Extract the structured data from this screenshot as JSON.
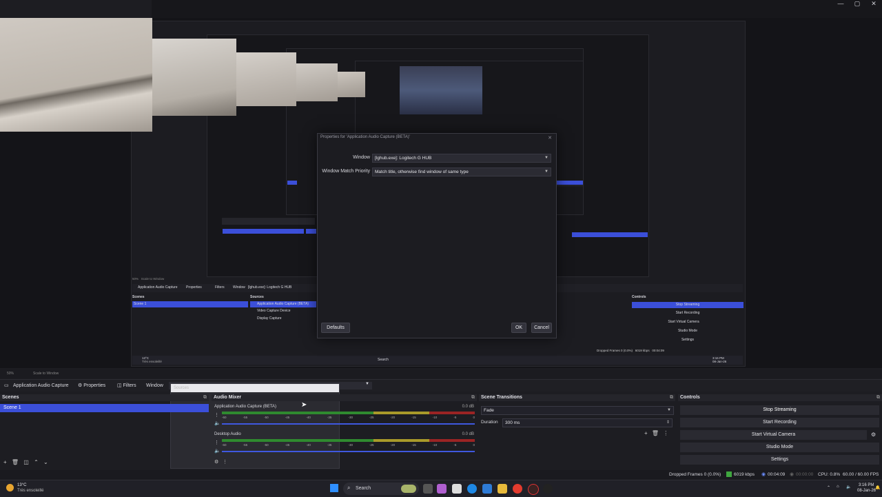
{
  "window_controls": {
    "minimize": "—",
    "maximize": "▢",
    "close": "✕"
  },
  "dialog": {
    "title": "Properties for 'Application Audio Capture (BETA)'",
    "window_label": "Window",
    "window_value": "[lghub.exe]: Logitech G HUB",
    "priority_label": "Window Match Priority",
    "priority_value": "Match title, otherwise find window of same type",
    "defaults_button": "Defaults",
    "ok_button": "OK",
    "cancel_button": "Cancel"
  },
  "nested": {
    "scenes": "Scenes",
    "scene1": "Scene 1",
    "sources": "Sources",
    "src1": "Application Audio Capture (BETA)",
    "src2": "Video Capture Device",
    "src3": "Display Capture",
    "controls": "Controls",
    "stop_streaming": "Stop Streaming",
    "start_recording": "Start Recording",
    "start_virtual_camera": "Start Virtual Camera",
    "studio_mode": "Studio Mode",
    "settings": "Settings",
    "search": "Search",
    "source_label": "Application Audio Capture",
    "properties": "Properties",
    "filters": "Filters",
    "window_word": "Window",
    "window_val": "[lghub.exe]: Logitech G HUB",
    "zoom": "50%",
    "scale": "Scale to Window",
    "dropped": "Dropped Frames 0 (0.0%)",
    "kbps": "6019 kbps",
    "time": "00:04:09",
    "clock_time": "3:16 PM",
    "clock_date": "08-Jan-26",
    "weather_temp": "13°C",
    "weather_desc": "Très ensoleillé"
  },
  "zoom_bar": {
    "zoom": "50%",
    "scale": "Scale to Window"
  },
  "toolbar": {
    "source_name": "Application Audio Capture",
    "properties": "Properties",
    "filters": "Filters",
    "window_label": "Window",
    "popup_header": "Sources"
  },
  "scenes": {
    "title": "Scenes",
    "items": [
      "Scene 1"
    ]
  },
  "audio_mixer": {
    "title": "Audio Mixer",
    "channels": [
      {
        "name": "Application Audio Capture (BETA)",
        "db": "0.0 dB"
      },
      {
        "name": "Desktop Audio",
        "db": "0.0 dB"
      }
    ],
    "ticks": [
      "-60",
      "-55",
      "-50",
      "-45",
      "-40",
      "-35",
      "-30",
      "-25",
      "-20",
      "-15",
      "-10",
      "-5",
      "0"
    ]
  },
  "transitions": {
    "title": "Scene Transitions",
    "type": "Fade",
    "duration_label": "Duration",
    "duration_value": "300 ms"
  },
  "controls": {
    "title": "Controls",
    "stop_streaming": "Stop Streaming",
    "start_recording": "Start Recording",
    "start_virtual_camera": "Start Virtual Camera",
    "studio_mode": "Studio Mode",
    "settings": "Settings"
  },
  "status": {
    "dropped_frames": "Dropped Frames 0 (0.0%)",
    "kbps": "6019 kbps",
    "live_time": "00:04:09",
    "rec_time": "00:00:00",
    "cpu": "CPU: 0.8%",
    "fps": "60.00 / 60.00 FPS"
  },
  "taskbar": {
    "weather_temp": "13°C",
    "weather_desc": "Très ensoleillé",
    "search": "Search",
    "time": "3:16 PM",
    "date": "08-Jan-26"
  },
  "colors": {
    "accent": "#3b4fd9",
    "bg": "#1d1d22",
    "meter_green": "#2f8a2f",
    "meter_yellow": "#a99a2a",
    "meter_red": "#9b2424"
  }
}
